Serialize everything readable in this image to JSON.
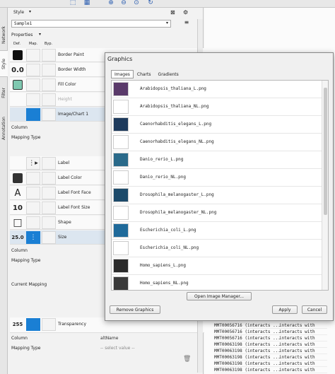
{
  "toolbar": {
    "icons": [
      "export-icon",
      "grid-icon",
      "zoom-in-icon",
      "zoom-out-icon",
      "zoom-fit-icon",
      "refresh-icon"
    ]
  },
  "vtabs": [
    "Network",
    "Style",
    "Filter",
    "Annotation"
  ],
  "panel": {
    "style_label": "Style",
    "style_value": "Sample1",
    "properties_label": "Properties",
    "col_def": "Def.",
    "col_map": "Map.",
    "col_byp": "Byp.",
    "rows_top": [
      {
        "label": "Border Paint",
        "def_color": "#111111"
      },
      {
        "label": "Border Width",
        "def_text": "0.0"
      },
      {
        "label": "Fill Color",
        "def_color": "#7fc8b0"
      },
      {
        "label": "Height"
      },
      {
        "label": "Image/Chart 1",
        "def_color": "#1a7fd4"
      }
    ],
    "column_label": "Column",
    "mapping_type_label": "Mapping Type",
    "rows_mid": [
      {
        "label": "Label",
        "def_text": "",
        "map_text": "⋮▸"
      },
      {
        "label": "Label Color",
        "def_color": "#333333"
      },
      {
        "label": "Label Font Face",
        "def_text": "A"
      },
      {
        "label": "Label Font Size",
        "def_text": "10"
      },
      {
        "label": "Shape",
        "def_text": "□"
      },
      {
        "label": "Size",
        "def_text": "25.0",
        "map_color": "#1a7fd4"
      }
    ],
    "current_mapping_label": "Current Mapping",
    "transparency_label": "Transparency",
    "transparency_value": "255",
    "transparency_column_value": "altName",
    "select_value_placeholder": "-- select value --"
  },
  "dialog": {
    "title": "Graphics",
    "tabs": [
      "Images",
      "Charts",
      "Gradients"
    ],
    "items": [
      {
        "name": "Arabidopsis_thaliana_L.png",
        "thumb": "#5a3a6a"
      },
      {
        "name": "Arabidopsis_thaliana_NL.png",
        "thumb": "#ffffff"
      },
      {
        "name": "Caenorhabditis_elegans_L.png",
        "thumb": "#1d3a5c"
      },
      {
        "name": "Caenorhabditis_elegans_NL.png",
        "thumb": "#ffffff"
      },
      {
        "name": "Danio_rerio_L.png",
        "thumb": "#2a6a8a"
      },
      {
        "name": "Danio_rerio_NL.png",
        "thumb": "#ffffff"
      },
      {
        "name": "Drosophila_melanogaster_L.png",
        "thumb": "#1c4a6a"
      },
      {
        "name": "Drosophila_melanogaster_NL.png",
        "thumb": "#ffffff"
      },
      {
        "name": "Escherichia_coli_L.png",
        "thumb": "#1f6a9a"
      },
      {
        "name": "Escherichia_coli_NL.png",
        "thumb": "#ffffff"
      },
      {
        "name": "Homo_sapiens_L.png",
        "thumb": "#2a2a2a"
      },
      {
        "name": "Homo_sapiens_NL.png",
        "thumb": "#3a3a3a"
      }
    ],
    "open_manager_label": "Open Image Manager...",
    "remove_label": "Remove Graphics",
    "apply_label": "Apply",
    "cancel_label": "Cancel"
  },
  "background_table": {
    "rows": [
      {
        "c1": "MMT00056716 (interacts ...",
        "c2": "interacts with"
      },
      {
        "c1": "MMT00056716 (interacts ...",
        "c2": "interacts with"
      },
      {
        "c1": "MMT00056716 (interacts ...",
        "c2": "interacts with"
      },
      {
        "c1": "MMT00063198 (interacts ...",
        "c2": "interacts with"
      },
      {
        "c1": "MMT00063198 (interacts ...",
        "c2": "interacts with"
      },
      {
        "c1": "MMT00063198 (interacts ...",
        "c2": "interacts with"
      },
      {
        "c1": "MMT00063198 (interacts ...",
        "c2": "interacts with"
      },
      {
        "c1": "MMT00063198 (interacts ...",
        "c2": "interacts with"
      }
    ]
  }
}
